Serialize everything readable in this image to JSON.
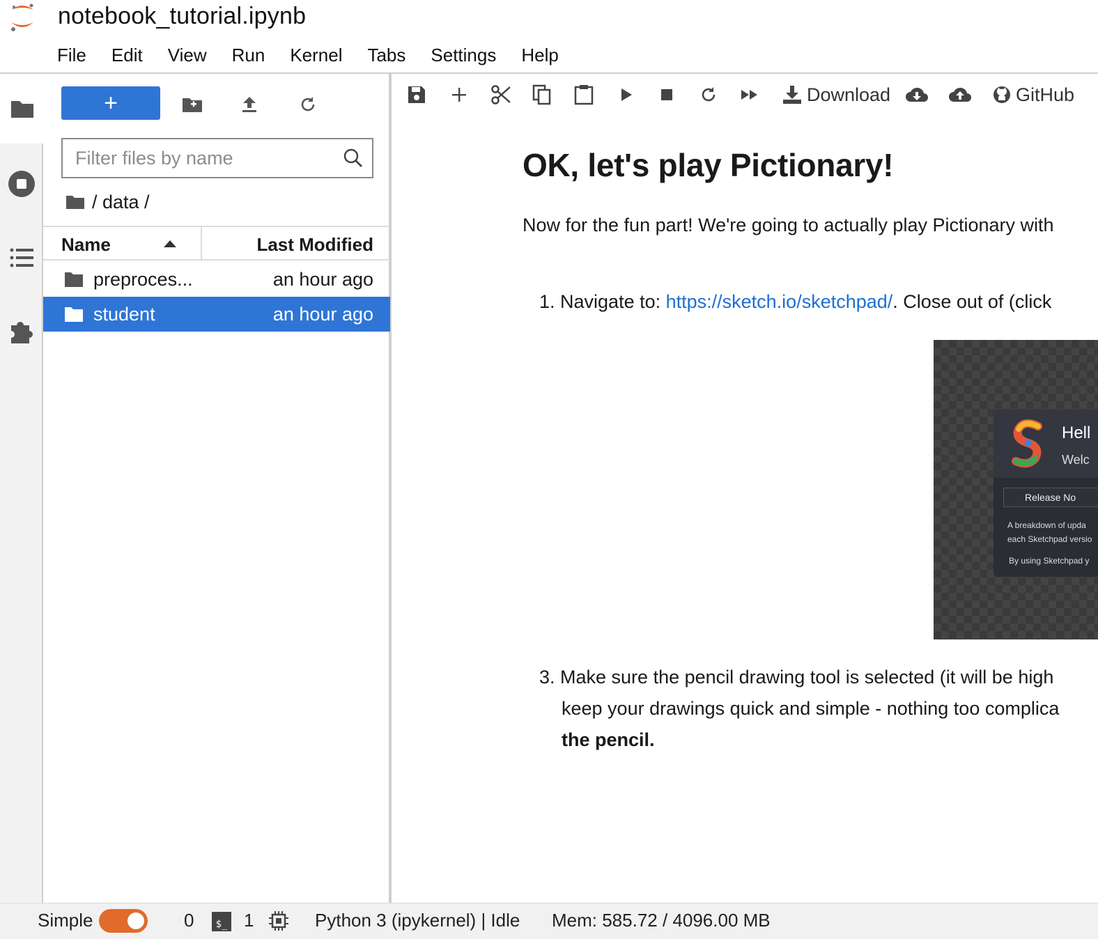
{
  "app": {
    "document_title": "notebook_tutorial.ipynb",
    "accent_color": "#2f75d6",
    "logo_color": "#e06b2a"
  },
  "menu": [
    "File",
    "Edit",
    "View",
    "Run",
    "Kernel",
    "Tabs",
    "Settings",
    "Help"
  ],
  "activity_bar": [
    "folder-icon",
    "stop-circle-icon",
    "list-icon",
    "puzzle-icon"
  ],
  "file_browser": {
    "new_button_label": "+",
    "filter_placeholder": "Filter files by name",
    "breadcrumb": "/ data /",
    "columns": {
      "name": "Name",
      "modified": "Last Modified"
    },
    "rows": [
      {
        "name": "preproces...",
        "modified": "an hour ago",
        "selected": false
      },
      {
        "name": "student",
        "modified": "an hour ago",
        "selected": true
      }
    ]
  },
  "notebook_toolbar": {
    "download_label": "Download",
    "github_label": "GitHub"
  },
  "notebook": {
    "heading": "OK, let's play Pictionary!",
    "intro": "Now for the fun part! We're going to actually play Pictionary with",
    "step1_prefix": "1. Navigate to: ",
    "step1_link": "https://sketch.io/sketchpad/",
    "step1_suffix": ". Close out of (click",
    "image": {
      "hello": "Hell",
      "welcome": "Welc",
      "release_button": "Release No",
      "text_line1": "A breakdown of upda",
      "text_line2": "each Sketchpad versio",
      "text_line3": "By using Sketchpad y"
    },
    "step3_line1": "3. Make sure the pencil drawing tool is selected (it will be high",
    "step3_line2": "keep your drawings quick and simple - nothing too complica",
    "step3_line3": "the pencil."
  },
  "status_bar": {
    "mode_label": "Simple",
    "kernel_count": "0",
    "terminal_count": "1",
    "kernel_status": "Python 3 (ipykernel) | Idle",
    "memory": "Mem: 585.72 / 4096.00 MB"
  }
}
